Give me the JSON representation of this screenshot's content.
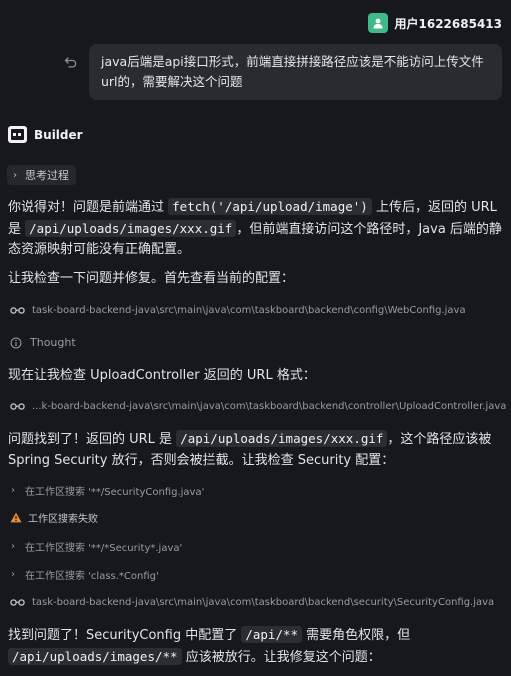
{
  "user": {
    "name": "用户1622685413",
    "avatar_color": "#3fb98a",
    "message": "java后端是api接口形式，前端直接拼接路径应该是不能访问上传文件url的，需要解决这个问题"
  },
  "assistant": {
    "name": "Builder",
    "thinking_label": "思考过程"
  },
  "content": {
    "p1_a": "你说得对！问题是前端通过 ",
    "p1_code1": "fetch('/api/upload/image')",
    "p1_b": " 上传后，返回的 URL 是 ",
    "p1_code2": "/api/uploads/images/xxx.gif",
    "p1_c": "，但前端直接访问这个路径时，Java 后端的静态资源映射可能没有正确配置。",
    "p2": "让我检查一下问题并修复。首先查看当前的配置：",
    "file1": "task-board-backend-java\\src\\main\\java\\com\\taskboard\\backend\\config\\WebConfig.java",
    "thought": "Thought",
    "p3": "现在让我检查 UploadController 返回的 URL 格式：",
    "file2": "...k-board-backend-java\\src\\main\\java\\com\\taskboard\\backend\\controller\\UploadController.java",
    "p4_a": "问题找到了！返回的 URL 是 ",
    "p4_code": "/api/uploads/images/xxx.gif",
    "p4_b": "，这个路径应该被 Spring Security 放行，否则会被拦截。让我检查 Security 配置：",
    "search1": "在工作区搜索 '**/SecurityConfig.java'",
    "search_fail": "工作区搜索失败",
    "search2": "在工作区搜索 '**/*Security*.java'",
    "search3": "在工作区搜索 'class.*Config'",
    "file3": "task-board-backend-java\\src\\main\\java\\com\\taskboard\\backend\\security\\SecurityConfig.java",
    "p5_a": "找到问题了！SecurityConfig 中配置了 ",
    "p5_code1": "/api/**",
    "p5_b": " 需要角色权限，但",
    "p5_code2": "/api/uploads/images/**",
    "p5_c": " 应该被放行。让我修复这个问题："
  },
  "colors": {
    "background": "#17181c",
    "bubble": "#2a2b31",
    "code_bg": "#2b2d33",
    "warning": "#e8893a",
    "muted": "#9a9ca4"
  }
}
